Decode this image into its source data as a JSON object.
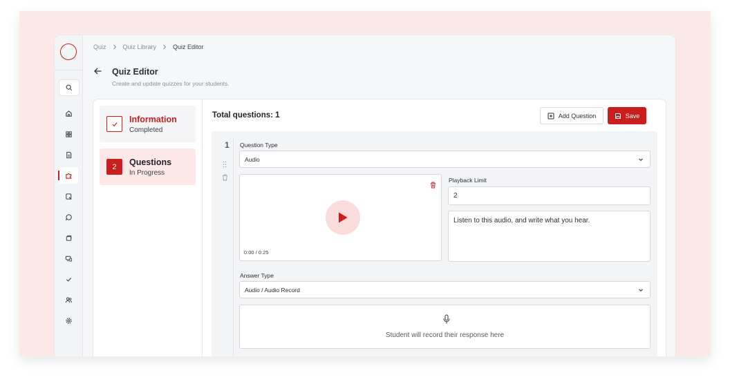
{
  "breadcrumb": [
    "Quiz",
    "Quiz Library",
    "Quiz Editor"
  ],
  "page": {
    "title": "Quiz Editor",
    "subtitle": "Create and update quizzes for your students."
  },
  "sidebar": {
    "icons": [
      "home-icon",
      "dashboard-icon",
      "document-icon",
      "puzzle-icon",
      "assignment-icon",
      "chat-icon",
      "library-icon",
      "devices-icon",
      "check-icon",
      "users-icon",
      "settings-icon"
    ],
    "active_index": 3
  },
  "steps": [
    {
      "number": "",
      "title": "Information",
      "status": "Completed"
    },
    {
      "number": "2",
      "title": "Questions",
      "status": "In Progress"
    }
  ],
  "editor": {
    "total_questions": "Total questions: 1",
    "add_question_label": "Add Question",
    "save_label": "Save"
  },
  "question": {
    "number": "1",
    "type_label": "Question Type",
    "type_value": "Audio",
    "audio_time": "0:00 / 0:25",
    "playback_limit_label": "Playback Limit",
    "playback_limit_value": "2",
    "prompt_text": "Listen to this audio, and write what you hear.",
    "answer_type_label": "Answer Type",
    "answer_type_value": "Audio / Audio Record",
    "record_hint": "Student will record their response here"
  },
  "colors": {
    "accent": "#c81e1e",
    "backdrop": "#fde8e8",
    "active_step_bg": "#fde8e8"
  }
}
